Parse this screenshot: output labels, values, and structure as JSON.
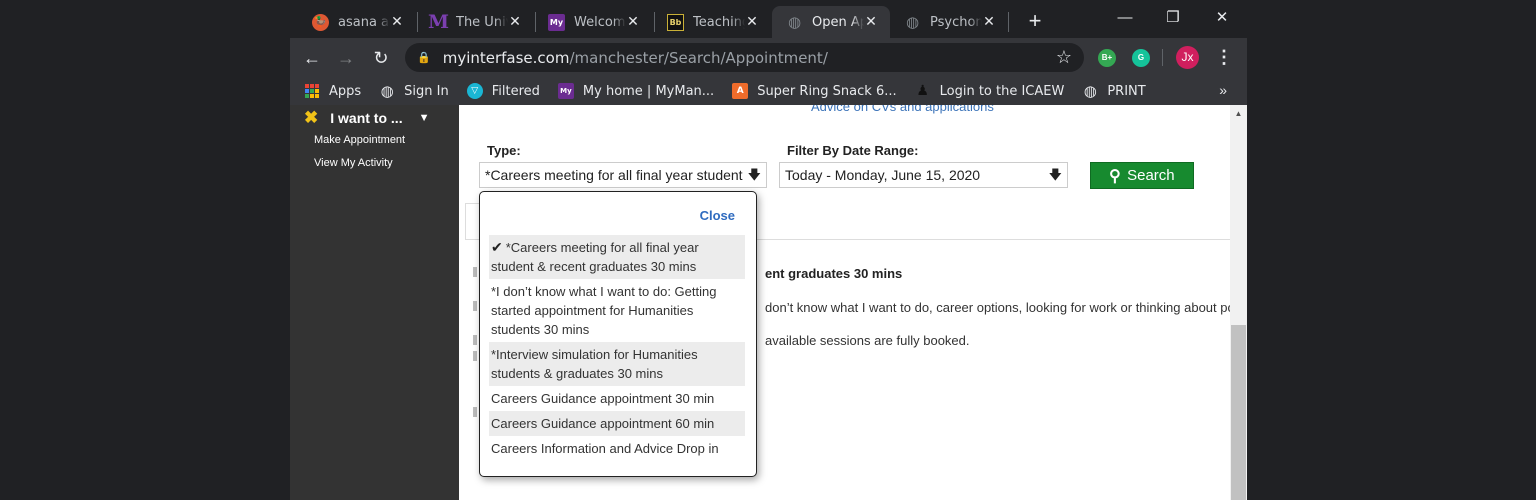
{
  "tabs": [
    {
      "title": "asana at",
      "favicon": "duckduckgo-icon",
      "active": false
    },
    {
      "title": "The Univ",
      "favicon": "M-logo-icon",
      "active": false
    },
    {
      "title": "Welcome",
      "favicon": "My-logo-icon",
      "active": false
    },
    {
      "title": "Teaching",
      "favicon": "blackboard-icon",
      "active": false
    },
    {
      "title": "Open Ap",
      "favicon": "globe-icon",
      "active": true
    },
    {
      "title": "Psychom",
      "favicon": "globe-icon",
      "active": false
    }
  ],
  "favicon_text": {
    "m": "M",
    "my": "My",
    "bb": "Bb"
  },
  "icons": {
    "close": "✕",
    "new_tab": "+",
    "minimize": "—",
    "restore": "❐",
    "window_close": "✕",
    "back": "←",
    "forward": "→",
    "reload": "↻",
    "lock": "🔒",
    "star": "☆",
    "more": "⋮",
    "bookmarks_overflow": "»",
    "globe": "◍",
    "dropdown_arrow": "🡇",
    "check": "✔",
    "search": "⚲",
    "caret_down": "▼",
    "scroll_up": "▲"
  },
  "address_bar": {
    "host": "myinterfase.com",
    "path": "/manchester/Search/Appointment/"
  },
  "extensions": [
    {
      "name": "bplus-extension",
      "label": "B+",
      "color": "#34a853"
    },
    {
      "name": "grammarly-extension",
      "label": "G",
      "color": "#15c39a"
    }
  ],
  "profile": {
    "initials": "Jx",
    "color": "#d01f5e"
  },
  "bookmarks": [
    {
      "label": "Apps",
      "icon": "apps-grid-icon"
    },
    {
      "label": "Sign In",
      "icon": "globe-icon"
    },
    {
      "label": "Filtered",
      "icon": "filter-icon"
    },
    {
      "label": "My home | MyMan...",
      "icon": "My-logo-icon"
    },
    {
      "label": "Super Ring Snack 6...",
      "icon": "snack-icon"
    },
    {
      "label": "Login to the ICAEW",
      "icon": "icaew-icon"
    },
    {
      "label": "PRINT",
      "icon": "globe-icon"
    }
  ],
  "sidebar": {
    "menu_title": "I want to ...",
    "menu_icon": "✖",
    "items": [
      {
        "label": "Make Appointment"
      },
      {
        "label": "View My Activity"
      }
    ]
  },
  "main": {
    "advice_link": "Advice on CVs and applications",
    "type_label": "Type:",
    "type_value": "*Careers meeting for all final year student",
    "date_label": "Filter By Date Range:",
    "date_value": "Today - Monday, June 15, 2020",
    "search_button": "Search",
    "result_title": "ent graduates 30 mins",
    "result_desc": "don’t know what I want to do, career options, looking for work or thinking about pos",
    "result_booked": "available sessions are fully booked."
  },
  "dropdown": {
    "close_label": "Close",
    "options": [
      {
        "label": "*Careers meeting for all final year student & recent graduates 30 mins",
        "selected": true,
        "shaded": true
      },
      {
        "label": "*I don’t know what I want to do: Getting started appointment for Humanities students 30 mins",
        "selected": false,
        "shaded": false
      },
      {
        "label": "*Interview simulation for Humanities students & graduates 30 mins",
        "selected": false,
        "shaded": true
      },
      {
        "label": "Careers Guidance appointment 30 min",
        "selected": false,
        "shaded": false
      },
      {
        "label": "Careers Guidance appointment 60 min",
        "selected": false,
        "shaded": true
      },
      {
        "label": "Careers Information and Advice Drop in",
        "selected": false,
        "shaded": false
      }
    ]
  }
}
